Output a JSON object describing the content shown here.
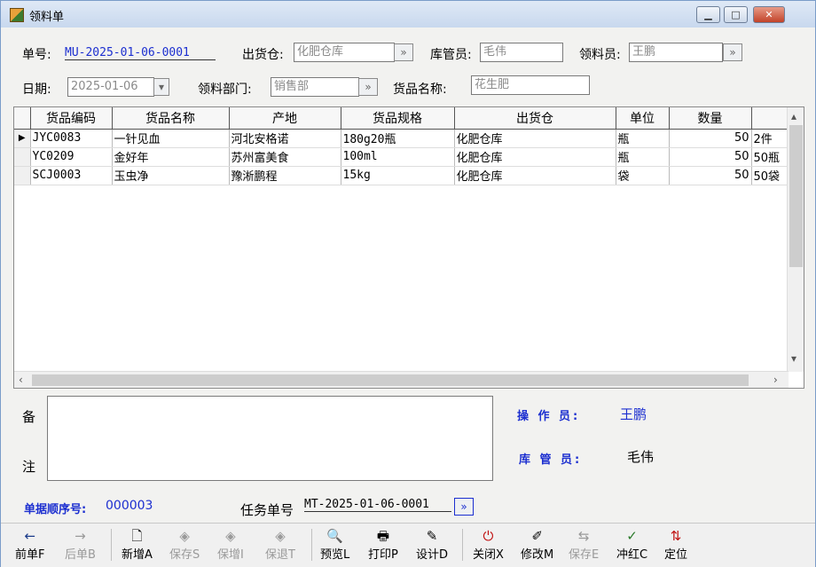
{
  "window": {
    "title": "领料单"
  },
  "header": {
    "doc_no_label": "单号:",
    "doc_no": "MU-2025-01-06-0001",
    "warehouse_label": "出货仓:",
    "warehouse": "化肥仓库",
    "keeper_label": "库管员:",
    "keeper": "毛伟",
    "picker_label": "领料员:",
    "picker": "王鹏",
    "date_label": "日期:",
    "date": "2025-01-06",
    "dept_label": "领料部门:",
    "dept": "销售部",
    "goods_name_label": "货品名称:",
    "goods_name": "花生肥",
    "lookup_glyph": "»"
  },
  "grid": {
    "columns": [
      "货品编码",
      "货品名称",
      "产地",
      "货品规格",
      "出货仓",
      "单位",
      "数量",
      ""
    ],
    "rows": [
      [
        "JYC0083",
        "一针见血",
        "河北安格诺",
        "180g20瓶",
        "化肥仓库",
        "瓶",
        "50",
        "2件"
      ],
      [
        "YC0209",
        "金好年",
        "苏州富美食",
        "100ml",
        "化肥仓库",
        "瓶",
        "50",
        "50瓶"
      ],
      [
        "SCJ0003",
        "玉虫净",
        "豫淅鹏程",
        "15kg",
        "化肥仓库",
        "袋",
        "50",
        "50袋"
      ]
    ],
    "current_row_marker": "▶"
  },
  "remarks": {
    "label_top": "备",
    "label_bottom": "注",
    "text": ""
  },
  "info": {
    "operator_label": "操 作 员:",
    "operator": "王鹏",
    "keeper_label": "库 管 员:",
    "keeper": "毛伟"
  },
  "footer": {
    "seq_label": "单据顺序号:",
    "seq": "000003",
    "task_label": "任务单号",
    "task_no": "MT-2025-01-06-0001",
    "task_lookup": "»"
  },
  "toolbar": [
    {
      "label": "前单F",
      "icon": "←",
      "enabled": true
    },
    {
      "label": "后单B",
      "icon": "→",
      "enabled": false
    },
    {
      "label": "新增A",
      "icon": "🗋",
      "enabled": true
    },
    {
      "label": "保存S",
      "icon": "◈",
      "enabled": false
    },
    {
      "label": "保增I",
      "icon": "◈",
      "enabled": false
    },
    {
      "label": "保退T",
      "icon": "◈",
      "enabled": false
    },
    {
      "label": "预览L",
      "icon": "🔍",
      "enabled": true
    },
    {
      "label": "打印P",
      "icon": "🖶",
      "enabled": true
    },
    {
      "label": "设计D",
      "icon": "✎",
      "enabled": true
    },
    {
      "label": "关闭X",
      "icon": "⏻",
      "enabled": true
    },
    {
      "label": "修改M",
      "icon": "✐",
      "enabled": true
    },
    {
      "label": "保存E",
      "icon": "⇆",
      "enabled": false
    },
    {
      "label": "冲红C",
      "icon": "✓",
      "enabled": true
    },
    {
      "label": "定位",
      "icon": "⇅",
      "enabled": true
    }
  ]
}
